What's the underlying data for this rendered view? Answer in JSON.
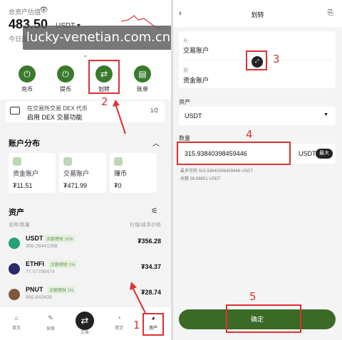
{
  "watermark": "lucky-venetian.com.cn",
  "left": {
    "total_label": "总资产估值",
    "eye_icon": "eye-icon",
    "amount": "483.50",
    "currency": "USDT",
    "today_pnl": "今日盈亏",
    "actions": [
      {
        "label": "充币",
        "icon": "deposit-icon"
      },
      {
        "label": "提币",
        "icon": "withdraw-icon"
      },
      {
        "label": "划转",
        "icon": "transfer-icon"
      },
      {
        "label": "账单",
        "icon": "bill-icon"
      }
    ],
    "promo": {
      "line1": "在交易所交易 DEX 代币",
      "line2": "启用 DEX 交易功能",
      "page": "1/2"
    },
    "distribution_title": "账户分布",
    "distribution": [
      {
        "name": "资金账户",
        "value": "₮11.51"
      },
      {
        "name": "交易账户",
        "value": "₮471.99"
      },
      {
        "name": "赚币",
        "value": "₮0"
      }
    ],
    "assets_title": "资产",
    "col_left": "名称/数量",
    "col_right": "价值/成本价格",
    "assets": [
      {
        "name": "USDT",
        "tag": "余额理财 10%",
        "qty": "356.28441398",
        "value": "₮356.28",
        "color": "#26a17b"
      },
      {
        "name": "ETHFI",
        "tag": "余额理财 1%",
        "qty": "77.57786474",
        "value": "₮34.37",
        "color": "#2b2b6b"
      },
      {
        "name": "PNUT",
        "tag": "余额理财 1%",
        "qty": "666.843406",
        "value": "₮28.74",
        "color": "#7a5a3a"
      }
    ],
    "nav": [
      {
        "label": "首页",
        "icon": "home-icon"
      },
      {
        "label": "探索",
        "icon": "explore-icon"
      },
      {
        "label": "交易",
        "icon": "trade-icon"
      },
      {
        "label": "借贷",
        "icon": "loan-icon"
      },
      {
        "label": "资产",
        "icon": "assets-icon"
      }
    ]
  },
  "right": {
    "title": "划转",
    "from_label": "从",
    "from_value": "交易账户",
    "to_label": "到",
    "to_value": "资金账户",
    "coin_label": "资产",
    "coin_value": "USDT",
    "amount_label": "数量",
    "amount_value": "315.93840398459446",
    "amount_unit": "USDT",
    "max_label": "最大",
    "avail_line": "最多可转 315.93840398459446 USDT",
    "loan_line": "总额 39.96801 USDT",
    "confirm_label": "确定"
  },
  "annotations": [
    "1",
    "2",
    "3",
    "4",
    "5"
  ],
  "colors": {
    "accent": "#3a7a2c",
    "annotation": "#e03030"
  }
}
